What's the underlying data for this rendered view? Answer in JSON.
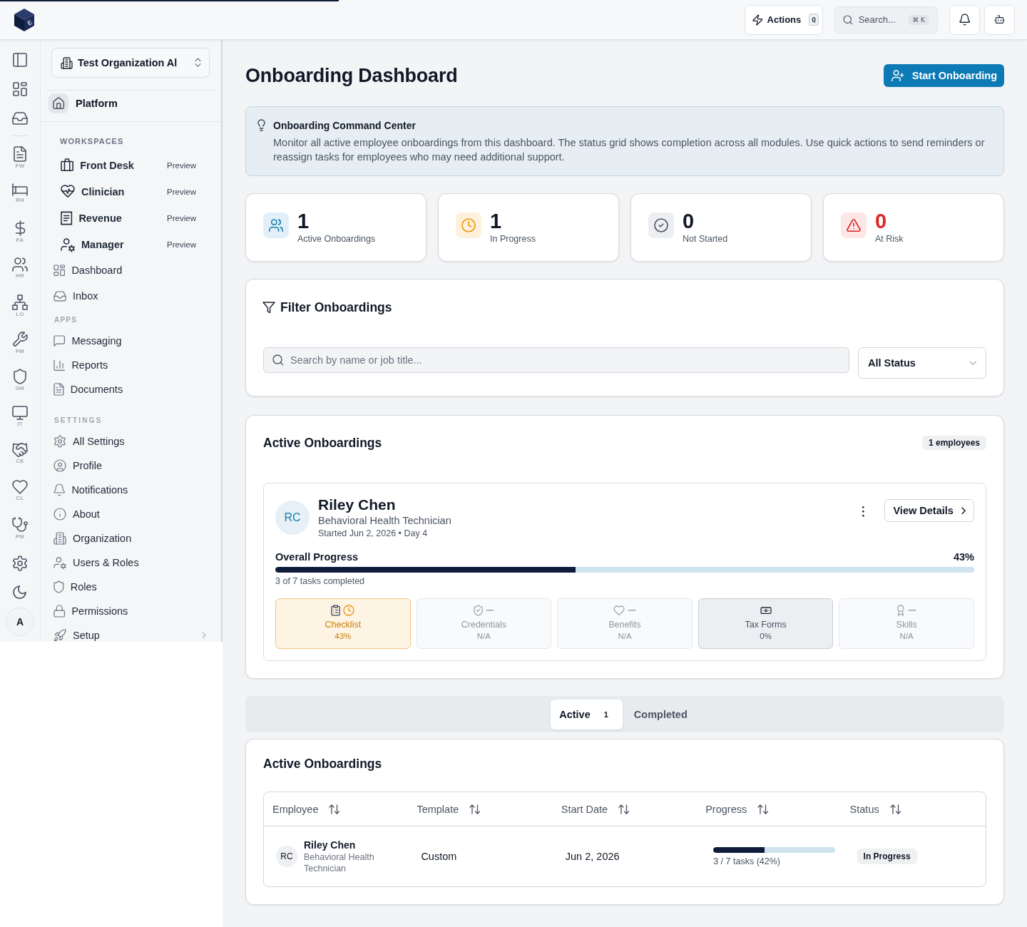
{
  "loader": {
    "level": 0.33
  },
  "topbar": {
    "logo_letter": "E",
    "actions": {
      "label": "Actions",
      "shortcut": "Q"
    },
    "search": {
      "label": "Search...",
      "shortcut": "⌘ K"
    }
  },
  "rail": {
    "modules": [
      {
        "code": "FW"
      },
      {
        "code": "RH"
      },
      {
        "code": "FA"
      },
      {
        "code": "HR"
      },
      {
        "code": "LO"
      },
      {
        "code": "FM"
      },
      {
        "code": "GR"
      },
      {
        "code": "IT"
      },
      {
        "code": "CE"
      },
      {
        "code": "CL"
      },
      {
        "code": "PM"
      }
    ],
    "avatar": "A"
  },
  "sidebar": {
    "org": "Test Organization Al",
    "platform": "Platform",
    "workspaces": {
      "heading": "WORKSPACES",
      "items": [
        {
          "label": "Front Desk",
          "badge": "Preview"
        },
        {
          "label": "Clinician",
          "badge": "Preview"
        },
        {
          "label": "Revenue",
          "badge": "Preview"
        },
        {
          "label": "Manager",
          "badge": "Preview"
        }
      ]
    },
    "groups": [
      {
        "items": [
          {
            "label": "Dashboard"
          },
          {
            "label": "Inbox"
          }
        ]
      },
      {
        "heading": "APPS",
        "items": [
          {
            "label": "Messaging"
          },
          {
            "label": "Reports"
          },
          {
            "label": "Documents"
          }
        ]
      },
      {
        "heading": "SETTINGS",
        "items": [
          {
            "label": "All Settings"
          },
          {
            "label": "Profile"
          },
          {
            "label": "Notifications"
          },
          {
            "label": "About"
          },
          {
            "label": "Organization"
          },
          {
            "label": "Users & Roles"
          },
          {
            "label": "Roles"
          },
          {
            "label": "Permissions"
          },
          {
            "label": "Setup",
            "expanded": false
          }
        ]
      }
    ]
  },
  "header": {
    "title": "Onboarding Dashboard",
    "primary_action": "Start Onboarding"
  },
  "banner": {
    "title": "Onboarding Command Center",
    "text": "Monitor all active employee onboardings from this dashboard. The status grid shows completion across all modules. Use quick actions to send reminders or reassign tasks for employees who may need additional support."
  },
  "stats": [
    {
      "kind": "active",
      "value": "1",
      "label": "Active Onboardings"
    },
    {
      "kind": "progress",
      "value": "1",
      "label": "In Progress"
    },
    {
      "kind": "pending",
      "value": "0",
      "label": "Not Started"
    },
    {
      "kind": "risk",
      "value": "0",
      "label": "At Risk"
    }
  ],
  "filter": {
    "title": "Filter Onboardings",
    "search": {
      "placeholder": "Search by name or job title..."
    },
    "status_select": {
      "value": "All Status"
    }
  },
  "active_panel": {
    "title": "Active Onboardings",
    "count_badge": "1 employees",
    "employees": [
      {
        "initials": "RC",
        "name": "Riley Chen",
        "role": "Behavioral Health Technician",
        "started": "Started Jun 2, 2026 • Day 4",
        "action": "View Details",
        "progress_label": "Overall Progress",
        "progress_value": "43%",
        "level": 0.43,
        "tasks_text": "3 of 7 tasks completed",
        "modules": [
          {
            "kind": "checklist",
            "name": "Checklist",
            "value": "43%",
            "in_progress": true,
            "disabled": false
          },
          {
            "kind": "credentials",
            "name": "Credentials",
            "value": "N/A",
            "in_progress": false,
            "disabled": true
          },
          {
            "kind": "benefits",
            "name": "Benefits",
            "value": "N/A",
            "in_progress": false,
            "disabled": true
          },
          {
            "kind": "tax",
            "name": "Tax Forms",
            "value": "0%",
            "in_progress": false,
            "disabled": false
          },
          {
            "kind": "skills",
            "name": "Skills",
            "value": "N/A",
            "in_progress": false,
            "disabled": true
          }
        ]
      }
    ]
  },
  "tabs": [
    {
      "label": "Active",
      "count": "1",
      "selected": true
    },
    {
      "label": "Completed",
      "selected": false
    }
  ],
  "table": {
    "title": "Active Onboardings",
    "columns": [
      "Employee",
      "Template",
      "Start Date",
      "Progress",
      "Status"
    ],
    "rows": [
      {
        "initials": "RC",
        "name": "Riley Chen",
        "role": "Behavioral Health Technician",
        "template": "Custom",
        "start_date": "Jun 2, 2026",
        "level": 0.42,
        "progress_text": "3 / 7 tasks (42%)",
        "status": "In Progress"
      }
    ]
  }
}
